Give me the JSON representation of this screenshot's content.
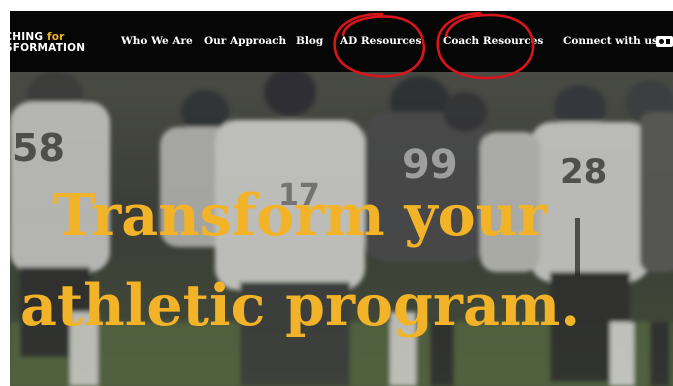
{
  "logo": {
    "line1_prefix": "ACHING",
    "line1_accent": "for",
    "line2": "NSFORMATION"
  },
  "nav": {
    "who_we_are": "Who We Are",
    "our_approach": "Our Approach",
    "blog": "Blog",
    "ad_resources": "AD Resources",
    "coach_resources": "Coach Resources",
    "connect": "Connect with us"
  },
  "hero": {
    "line1": "Transform your",
    "line2": "athletic program.",
    "jersey_numbers": [
      "58",
      "99",
      "28",
      "17"
    ]
  },
  "colors": {
    "navbar": "#060606",
    "accent": "#f2b328",
    "annotation": "#d9141b"
  },
  "icons": {
    "brand": "brand-icon"
  }
}
